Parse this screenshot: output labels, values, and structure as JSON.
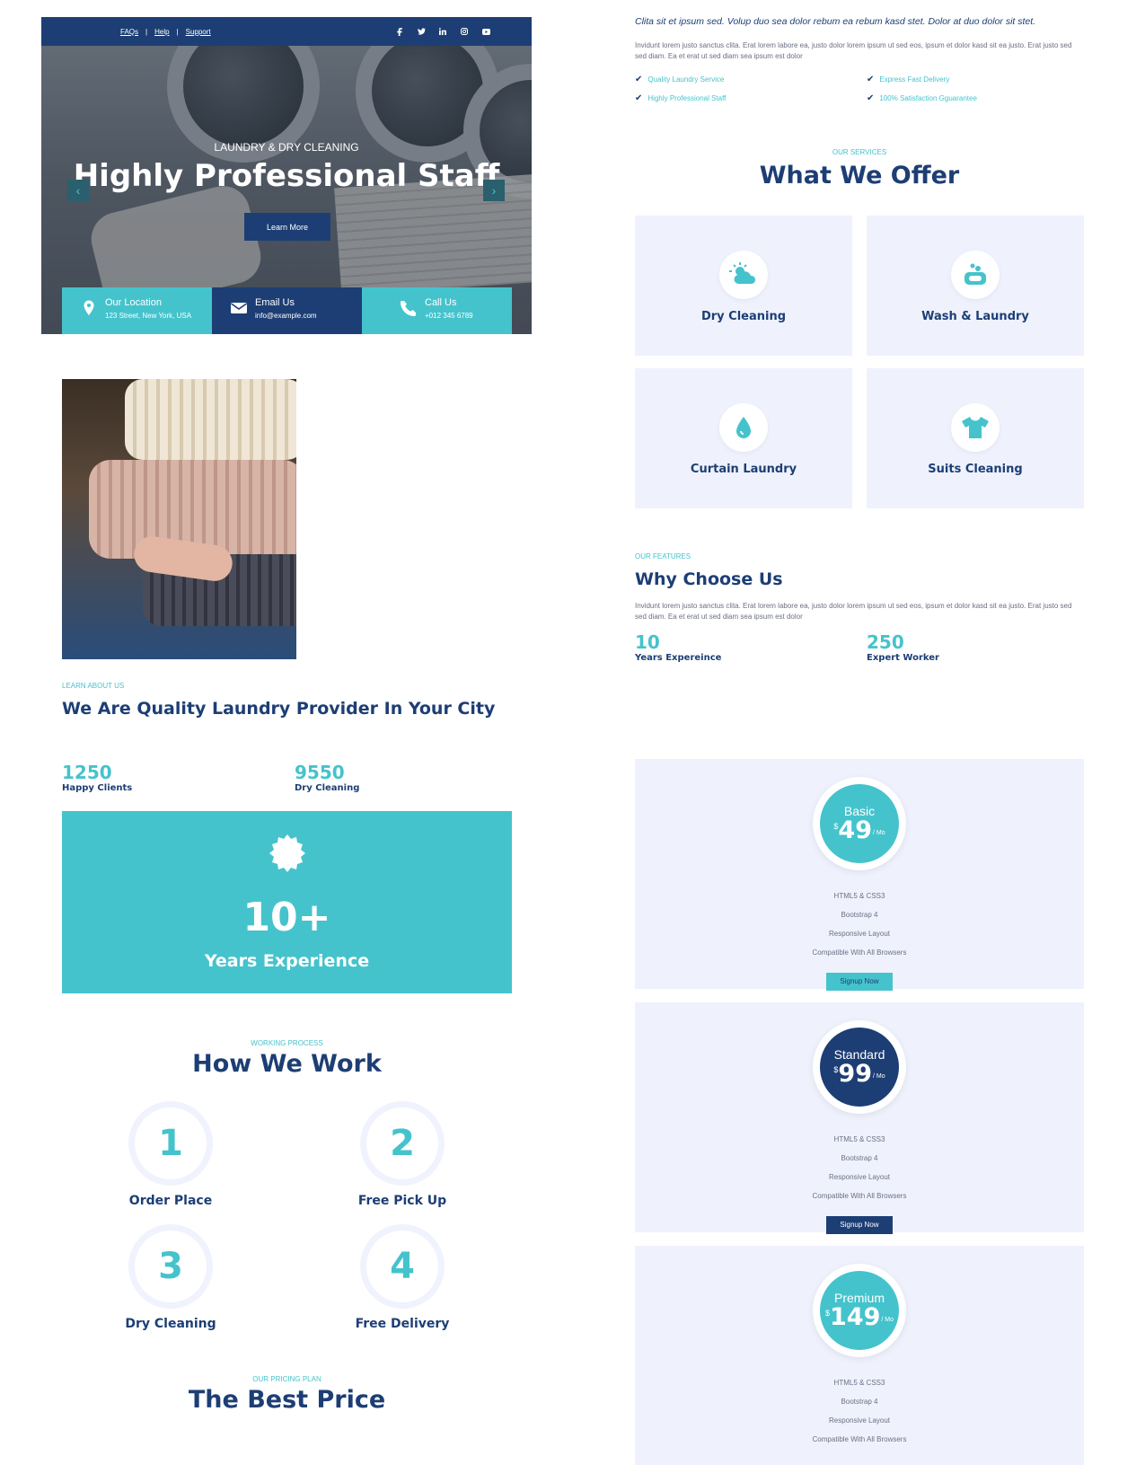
{
  "topbar": {
    "links": [
      "FAQs",
      "Help",
      "Support"
    ],
    "separator": "|",
    "social": [
      "facebook-icon",
      "twitter-icon",
      "linkedin-icon",
      "instagram-icon",
      "youtube-icon"
    ]
  },
  "hero": {
    "subtitle": "LAUNDRY & DRY CLEANING",
    "title": "Highly Professional Staff",
    "button": "Learn More",
    "prev_arrow": "‹",
    "next_arrow": "›"
  },
  "contacts": [
    {
      "icon": "map-pin-icon",
      "title": "Our Location",
      "value": "123 Street, New York, USA",
      "color": "#45c3cc"
    },
    {
      "icon": "envelope-icon",
      "title": "Email Us",
      "value": "info@example.com",
      "color": "#1d3e74"
    },
    {
      "icon": "phone-icon",
      "title": "Call Us",
      "value": "+012 345 6789",
      "color": "#45c3cc"
    }
  ],
  "about": {
    "eyebrow": "LEARN ABOUT US",
    "heading": "We Are Quality Laundry Provider In Your City",
    "stats": [
      {
        "number": "1250",
        "label": "Happy Clients"
      },
      {
        "number": "9550",
        "label": "Dry Cleaning"
      }
    ],
    "experience": {
      "number": "10+",
      "label": "Years Experience"
    }
  },
  "intro": {
    "italic": "Clita sit et ipsum sed. Volup duo sea dolor rebum ea rebum kasd stet. Dolor at duo dolor sit stet.",
    "body": "Invidunt lorem justo sanctus clita. Erat lorem labore ea, justo dolor lorem ipsum ut sed eos, ipsum et dolor kasd sit ea justo. Erat justo sed sed diam. Ea et erat ut sed diam sea ipsum est dolor",
    "checks": [
      "Quality Laundry Service",
      "Express Fast Delivery",
      "Highly Professional Staff",
      "100% Satisfaction Gguarantee"
    ]
  },
  "services": {
    "eyebrow": "OUR SERVICES",
    "heading": "What We Offer",
    "items": [
      {
        "label": "Dry Cleaning",
        "icon": "sun-cloud-icon"
      },
      {
        "label": "Wash & Laundry",
        "icon": "soap-icon"
      },
      {
        "label": "Curtain Laundry",
        "icon": "water-drop-icon"
      },
      {
        "label": "Suits Cleaning",
        "icon": "tshirt-icon"
      }
    ]
  },
  "features": {
    "eyebrow": "OUR FEATURES",
    "heading": "Why Choose Us",
    "body": "Invidunt lorem justo sanctus clita. Erat lorem labore ea, justo dolor lorem ipsum ut sed eos, ipsum et dolor kasd sit ea justo. Erat justo sed sed diam. Ea et erat ut sed diam sea ipsum est dolor",
    "stats": [
      {
        "number": "10",
        "label": "Years Expereince"
      },
      {
        "number": "250",
        "label": "Expert Worker"
      }
    ]
  },
  "process": {
    "eyebrow": "WORKING PROCESS",
    "heading": "How We Work",
    "steps": [
      {
        "number": "1",
        "label": "Order Place"
      },
      {
        "number": "2",
        "label": "Free Pick Up"
      },
      {
        "number": "3",
        "label": "Dry Cleaning"
      },
      {
        "number": "4",
        "label": "Free Delivery"
      }
    ]
  },
  "pricing": {
    "eyebrow": "OUR PRICING PLAN",
    "heading": "The Best Price",
    "plans": [
      {
        "name": "Basic",
        "currency": "$",
        "amount": "49",
        "period": "/ Mo",
        "color": "#45c3cc",
        "features": [
          "HTML5 & CSS3",
          "Bootstrap 4",
          "Responsive Layout",
          "Compatible With All Browsers"
        ],
        "button": "Signup Now"
      },
      {
        "name": "Standard",
        "currency": "$",
        "amount": "99",
        "period": "/ Mo",
        "color": "#1d3e74",
        "features": [
          "HTML5 & CSS3",
          "Bootstrap 4",
          "Responsive Layout",
          "Compatible With All Browsers"
        ],
        "button": "Signup Now"
      },
      {
        "name": "Premium",
        "currency": "$",
        "amount": "149",
        "period": "/ Mo",
        "color": "#45c3cc",
        "features": [
          "HTML5 & CSS3",
          "Bootstrap 4",
          "Responsive Layout",
          "Compatible With All Browsers"
        ]
      }
    ]
  },
  "colors": {
    "primary": "#1d3e74",
    "accent": "#45c3cc",
    "panel": "#eff2fd"
  }
}
